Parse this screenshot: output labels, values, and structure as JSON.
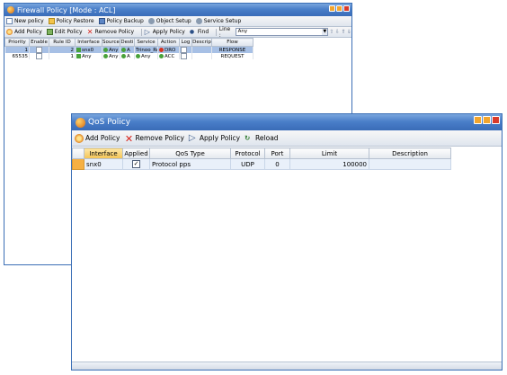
{
  "firewall": {
    "title": "Firewall Policy [Mode : ACL]",
    "toolbar1": {
      "new_policy": "New policy",
      "policy_restore": "Policy Restore",
      "policy_backup": "Policy Backup",
      "object_setup": "Object Setup",
      "service_setup": "Service Setup"
    },
    "toolbar2": {
      "add_policy": "Add Policy",
      "edit_policy": "Edit Policy",
      "remove_policy": "Remove Policy",
      "apply_policy": "Apply Policy",
      "find": "Find",
      "line_label": "Line :",
      "line_value": "Any"
    },
    "columns": [
      "Priority",
      "Enable",
      "Rule ID",
      "Interface",
      "Source",
      "Desti",
      "Service",
      "Action",
      "Log",
      "Descrip",
      "Flow"
    ],
    "rows": [
      {
        "priority": "1",
        "rule_id": "2",
        "interface": "snx0",
        "source": "Any",
        "dest": "A",
        "service": "Trinoo_Re",
        "action": "DRO",
        "flow": "RESPONSE"
      },
      {
        "priority": "65535",
        "rule_id": "1",
        "interface": "Any",
        "source": "Any",
        "dest": "A",
        "service": "Any",
        "action": "ACC",
        "flow": "REQUEST"
      }
    ]
  },
  "qos": {
    "title": "QoS Policy",
    "toolbar": {
      "add_policy": "Add Policy",
      "remove_policy": "Remove Policy",
      "apply_policy": "Apply Policy",
      "reload": "Reload"
    },
    "columns": {
      "interface": "Interface",
      "applied": "Applied",
      "qos_type": "QoS Type",
      "protocol": "Protocol",
      "port": "Port",
      "limit": "Limit",
      "description": "Description"
    },
    "rows": [
      {
        "interface": "snx0",
        "applied": "✓",
        "qos_type": "Protocol pps",
        "protocol": "UDP",
        "port": "0",
        "limit": "100000",
        "description": ""
      }
    ]
  }
}
